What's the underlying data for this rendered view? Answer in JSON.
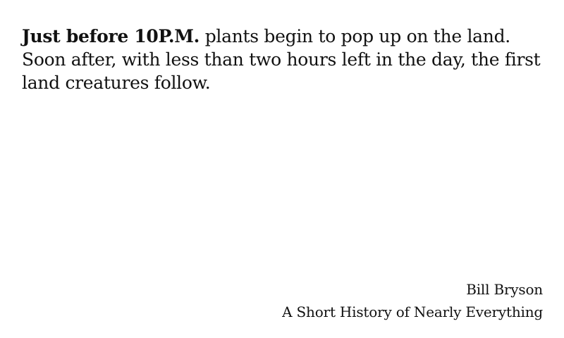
{
  "quote": {
    "emphasis": "Just before 10P.M.",
    "text": " plants begin to pop up on the land. Soon after, with less than two hours left in the day, the first land creatures follow."
  },
  "attribution": {
    "author": "Bill Bryson",
    "book": "A Short History of Nearly Everything"
  }
}
